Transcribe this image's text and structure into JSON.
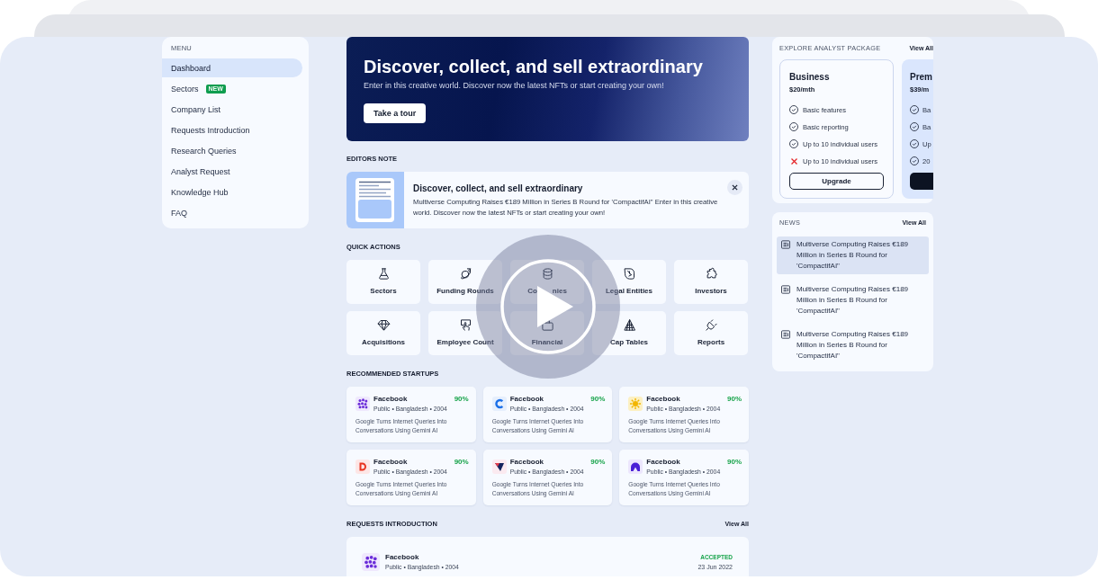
{
  "sidebar": {
    "heading": "MENU",
    "items": [
      {
        "label": "Dashboard",
        "selected": true
      },
      {
        "label": "Sectors",
        "selected": false,
        "badge": "NEW"
      },
      {
        "label": "Company List",
        "selected": false
      },
      {
        "label": "Requests Introduction",
        "selected": false
      },
      {
        "label": "Research Queries",
        "selected": false
      },
      {
        "label": "Analyst Request",
        "selected": false
      },
      {
        "label": "Knowledge Hub",
        "selected": false
      },
      {
        "label": "FAQ",
        "selected": false
      }
    ]
  },
  "hero": {
    "title": "Discover, collect, and sell extraordinary",
    "subtitle": "Enter in this creative world. Discover now the latest NFTs or start creating your own!",
    "button": "Take a tour"
  },
  "editors_note": {
    "heading": "EDITORS NOTE",
    "title": "Discover, collect, and sell extraordinary",
    "body": "Multiverse Computing Raises €189 Million in Series B Round for 'CompactifAI\" Enter in this creative world. Discover now the latest NFTs or start creating your own!"
  },
  "quick_actions": {
    "heading": "QUICK ACTIONS",
    "items": [
      {
        "label": "Sectors"
      },
      {
        "label": "Funding Rounds"
      },
      {
        "label": "Co",
        "label_end": "nies"
      },
      {
        "label": "Legal Entities"
      },
      {
        "label": "Investors"
      },
      {
        "label": "Acquisitions"
      },
      {
        "label": "Employee Count"
      },
      {
        "label": "Financial"
      },
      {
        "label": "Cap Tables"
      },
      {
        "label": "Reports"
      }
    ]
  },
  "startups": {
    "heading": "RECOMMENDED STARTUPS",
    "items": [
      {
        "name": "Facebook",
        "meta": "Public • Bangladesh • 2004",
        "score": "90%",
        "description": "Google Turns Internet Queries Into Conversations Using Gemini AI"
      },
      {
        "name": "Facebook",
        "meta": "Public • Bangladesh • 2004",
        "score": "90%",
        "description": "Google Turns Internet Queries Into Conversations Using Gemini AI"
      },
      {
        "name": "Facebook",
        "meta": "Public • Bangladesh • 2004",
        "score": "90%",
        "description": "Google Turns Internet Queries Into Conversations Using Gemini AI"
      },
      {
        "name": "Facebook",
        "meta": "Public • Bangladesh • 2004",
        "score": "90%",
        "description": "Google Turns Internet Queries Into Conversations Using Gemini AI"
      },
      {
        "name": "Facebook",
        "meta": "Public • Bangladesh • 2004",
        "score": "90%",
        "description": "Google Turns Internet Queries Into Conversations Using Gemini AI"
      },
      {
        "name": "Facebook",
        "meta": "Public • Bangladesh • 2004",
        "score": "90%",
        "description": "Google Turns Internet Queries Into Conversations Using Gemini AI"
      }
    ]
  },
  "requests": {
    "heading": "REQUESTS INTRODUCTION",
    "link": "View All",
    "items": [
      {
        "name": "Facebook",
        "meta": "Public • Bangladesh • 2004",
        "status": "ACCEPTED",
        "date": "23 Jun 2022"
      }
    ]
  },
  "packages": {
    "heading": "EXPLORE ANALYST PACKAGE",
    "link": "View All",
    "plans": [
      {
        "name": "Business",
        "price": "$20/mth",
        "featured": false,
        "features": [
          {
            "label": "Basic features",
            "included": true
          },
          {
            "label": "Basic reporting",
            "included": true
          },
          {
            "label": "Up to 10 individual users",
            "included": true
          },
          {
            "label": "Up to 10 individual users",
            "included": false
          }
        ],
        "button": "Upgrade"
      },
      {
        "name": "Prem",
        "price": "$39/m",
        "featured": true,
        "features": [
          {
            "label": "Ba",
            "included": true
          },
          {
            "label": "Ba",
            "included": true
          },
          {
            "label": "Up",
            "included": true
          },
          {
            "label": "20",
            "included": true
          }
        ]
      }
    ]
  },
  "news": {
    "heading": "NEWS",
    "link": "View All",
    "items": [
      {
        "title": "Multiverse Computing Raises €189 Million in Series B Round for 'CompactifAI\"",
        "selected": true
      },
      {
        "title": "Multiverse Computing Raises €189 Million in Series B Round for 'CompactifAI\"",
        "selected": false
      },
      {
        "title": "Multiverse Computing Raises €189 Million in Series B Round for 'CompactifAI\"",
        "selected": false
      }
    ]
  }
}
